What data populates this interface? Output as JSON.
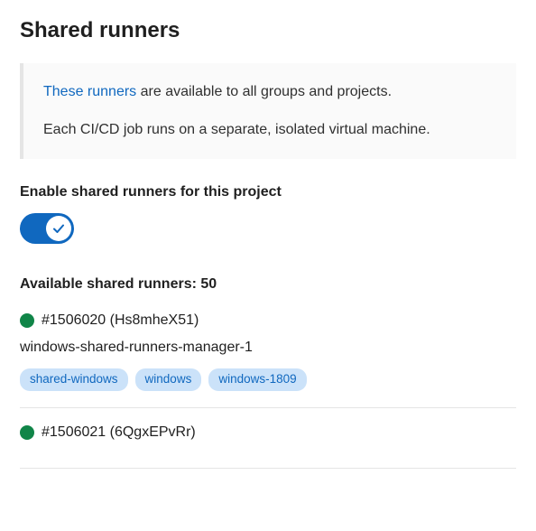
{
  "title": "Shared runners",
  "info": {
    "link_text": "These runners",
    "link_tail": " are available to all groups and projects.",
    "line2": "Each CI/CD job runs on a separate, isolated virtual machine."
  },
  "toggle": {
    "label": "Enable shared runners for this project",
    "enabled": true
  },
  "available": {
    "prefix": "Available shared runners: ",
    "count": "50"
  },
  "runners": [
    {
      "status_color": "#108548",
      "id": "#1506020 (Hs8mheX51)",
      "description": "windows-shared-runners-manager-1",
      "tags": [
        "shared-windows",
        "windows",
        "windows-1809"
      ]
    },
    {
      "status_color": "#108548",
      "id": "#1506021 (6QgxEPvRr)"
    }
  ]
}
